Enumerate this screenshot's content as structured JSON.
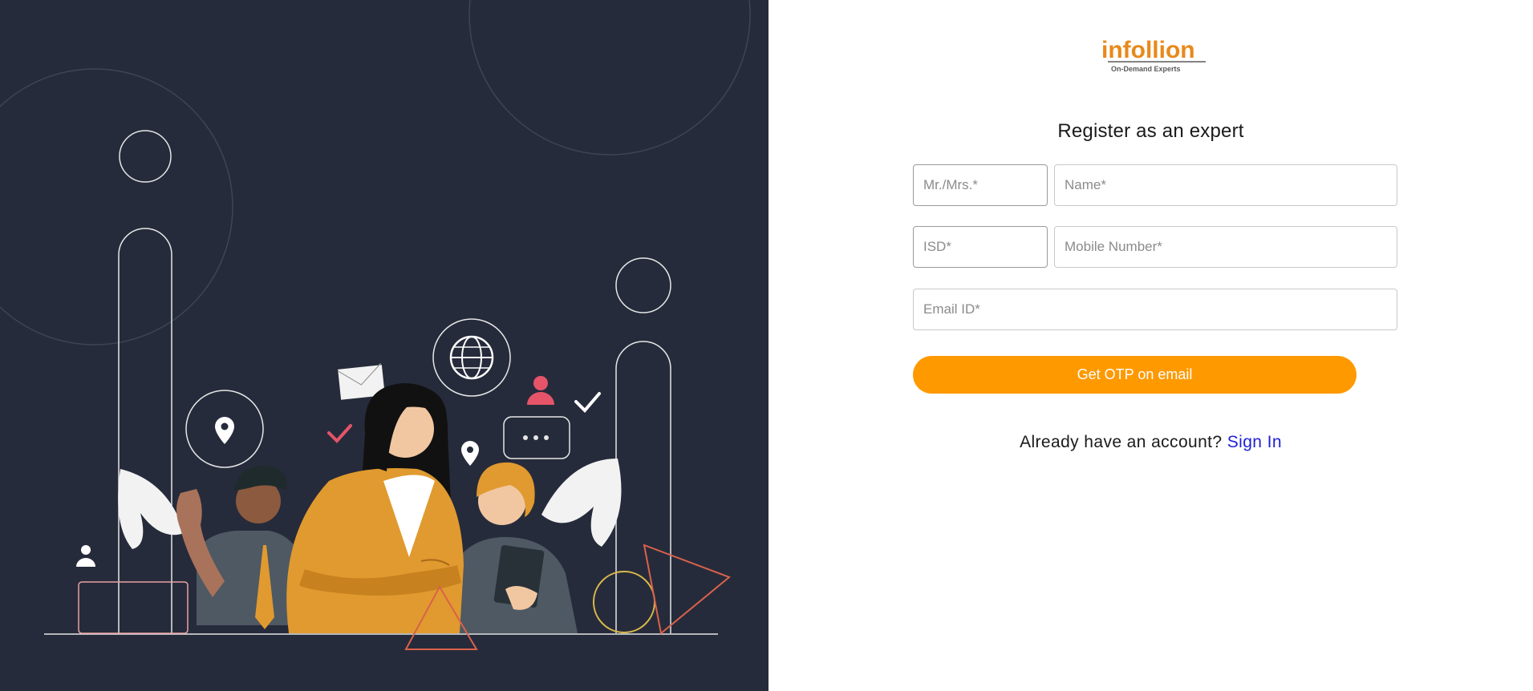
{
  "illustration": {
    "alt_subject": "team of experts illustration"
  },
  "brand": {
    "logo_text": "infollion",
    "tagline": "On-Demand Experts",
    "accent_color": "#e8891b",
    "dark_color": "#5b5b5b"
  },
  "form": {
    "title": "Register as an expert",
    "salutation_placeholder": "Mr./Mrs.*",
    "name_placeholder": "Name*",
    "isd_placeholder": "ISD*",
    "mobile_placeholder": "Mobile Number*",
    "email_placeholder": "Email ID*",
    "otp_button_label": "Get OTP on email"
  },
  "signin": {
    "prompt": "Already have an account?",
    "link_label": "Sign In"
  },
  "colors": {
    "panel_bg": "#262b3b",
    "button": "#ff9900",
    "link": "#1f1fd6"
  }
}
